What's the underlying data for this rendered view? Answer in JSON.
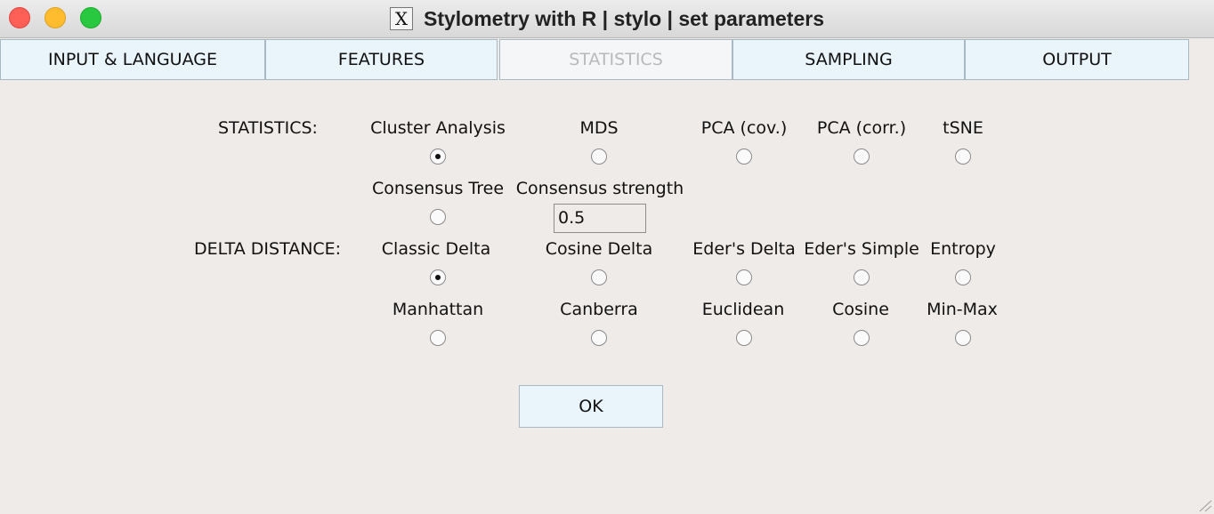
{
  "window": {
    "title": "Stylometry with R | stylo | set parameters",
    "app_icon": "X"
  },
  "tabs": [
    {
      "label": "INPUT & LANGUAGE",
      "active": false
    },
    {
      "label": "FEATURES",
      "active": false
    },
    {
      "label": "STATISTICS",
      "active": true
    },
    {
      "label": "SAMPLING",
      "active": false
    },
    {
      "label": "OUTPUT",
      "active": false
    }
  ],
  "statistics": {
    "label": "STATISTICS:",
    "options": [
      {
        "label": "Cluster Analysis",
        "selected": true
      },
      {
        "label": "MDS",
        "selected": false
      },
      {
        "label": "PCA (cov.)",
        "selected": false
      },
      {
        "label": "PCA (corr.)",
        "selected": false
      },
      {
        "label": "tSNE",
        "selected": false
      }
    ],
    "consensus_tree": {
      "label": "Consensus Tree",
      "selected": false
    },
    "consensus_strength": {
      "label": "Consensus strength",
      "value": "0.5"
    }
  },
  "delta_distance": {
    "label": "DELTA DISTANCE:",
    "options": [
      {
        "label": "Classic Delta",
        "selected": true
      },
      {
        "label": "Cosine Delta",
        "selected": false
      },
      {
        "label": "Eder's Delta",
        "selected": false
      },
      {
        "label": "Eder's Simple",
        "selected": false
      },
      {
        "label": "Entropy",
        "selected": false
      },
      {
        "label": "Manhattan",
        "selected": false
      },
      {
        "label": "Canberra",
        "selected": false
      },
      {
        "label": "Euclidean",
        "selected": false
      },
      {
        "label": "Cosine",
        "selected": false
      },
      {
        "label": "Min-Max",
        "selected": false
      }
    ]
  },
  "ok_button": {
    "label": "OK"
  },
  "colors": {
    "background": "#efebe8",
    "tab_bg": "#e9f4fb",
    "active_tab_text": "#b9b9b9"
  }
}
